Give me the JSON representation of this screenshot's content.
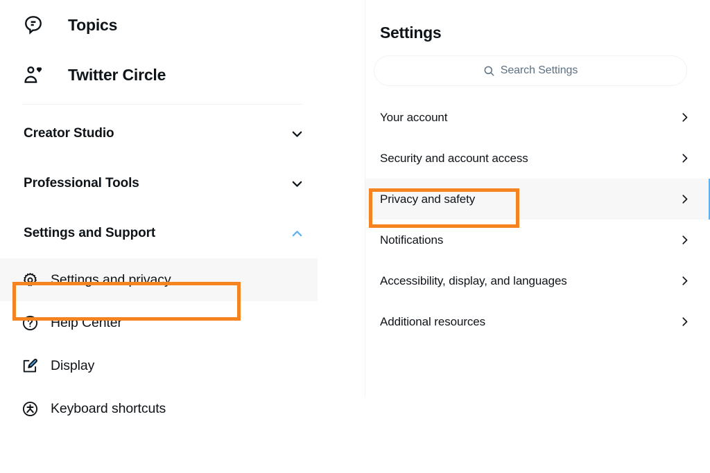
{
  "left_nav": {
    "primary_items": [
      {
        "label": "Topics",
        "icon": "topics-speech-bubble-icon"
      },
      {
        "label": "Twitter Circle",
        "icon": "person-heart-icon"
      }
    ],
    "groups": [
      {
        "label": "Creator Studio",
        "chevron": "chevron-down-icon",
        "expanded": false,
        "chevron_color": "#0f1419"
      },
      {
        "label": "Professional Tools",
        "chevron": "chevron-down-icon",
        "expanded": false,
        "chevron_color": "#0f1419"
      },
      {
        "label": "Settings and Support",
        "chevron": "chevron-up-icon",
        "expanded": true,
        "chevron_color": "#5eb0ef"
      }
    ],
    "sub_items": [
      {
        "label": "Settings and privacy",
        "icon": "gear-icon",
        "active": true
      },
      {
        "label": "Help Center",
        "icon": "question-circle-icon",
        "active": false
      },
      {
        "label": "Display",
        "icon": "display-paintbrush-icon",
        "active": false
      },
      {
        "label": "Keyboard shortcuts",
        "icon": "keyboard-shortcuts-asterisk-icon",
        "active": false
      }
    ]
  },
  "settings_panel": {
    "title": "Settings",
    "search": {
      "placeholder": "Search Settings",
      "value": "",
      "icon": "search-icon"
    },
    "rows": [
      {
        "label": "Your account",
        "chevron": "chevron-right-icon",
        "active": false
      },
      {
        "label": "Security and account access",
        "chevron": "chevron-right-icon",
        "active": false
      },
      {
        "label": "Privacy and safety",
        "chevron": "chevron-right-icon",
        "active": true
      },
      {
        "label": "Notifications",
        "chevron": "chevron-right-icon",
        "active": false
      },
      {
        "label": "Accessibility, display, and languages",
        "chevron": "chevron-right-icon",
        "active": false
      },
      {
        "label": "Additional resources",
        "chevron": "chevron-right-icon",
        "active": false
      }
    ]
  },
  "annotations": {
    "highlight_color": "#f5831f",
    "targets": [
      "Settings and privacy",
      "Privacy and safety"
    ]
  },
  "colors": {
    "accent_blue": "#5eb0ef",
    "text_primary": "#0f1419",
    "text_secondary": "#5b7083",
    "row_hover_bg": "#f7f7f7",
    "divider": "#eff3f4",
    "highlight_orange": "#f5831f"
  }
}
